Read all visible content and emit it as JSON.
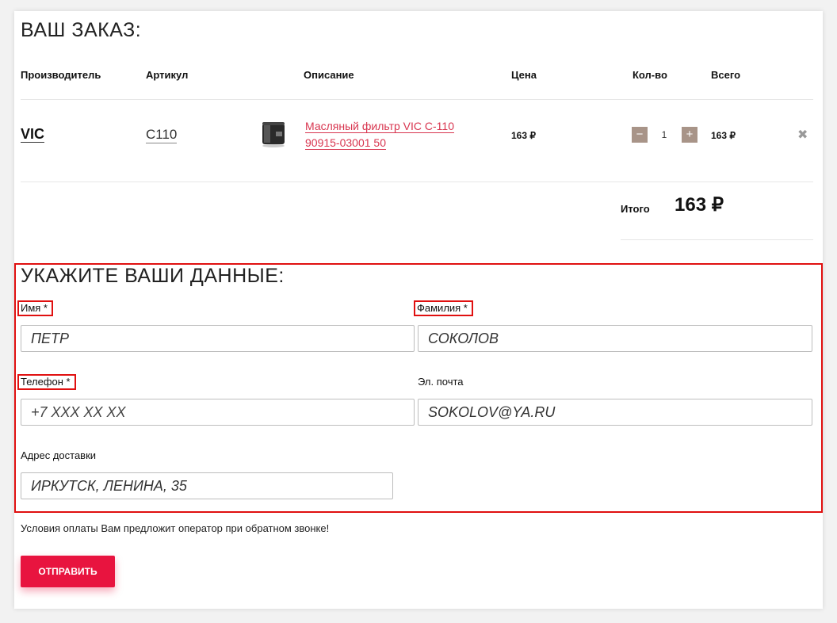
{
  "order": {
    "title": "ВАШ ЗАКАЗ:",
    "columns": [
      "Производитель",
      "Артикул",
      "Описание",
      "Цена",
      "Кол-во",
      "Всего"
    ],
    "item": {
      "brand": "VIC",
      "article": "C110",
      "description_line1": "Масляный фильтр VIC C-110",
      "description_line2": "90915-03001 50",
      "price": "163 ₽",
      "qty_minus": "−",
      "qty": "1",
      "qty_plus": "+",
      "total": "163 ₽",
      "remove": "✖"
    },
    "total_label": "Итого",
    "total_value": "163 ₽"
  },
  "form": {
    "title": "УКАЖИТЕ ВАШИ ДАННЫЕ:",
    "first_name": {
      "label": "Имя *",
      "value": "ПЕТР"
    },
    "last_name": {
      "label": "Фамилия *",
      "value": "СОКОЛОВ"
    },
    "phone": {
      "label": "Телефон *",
      "value": "+7 XXX XX XX"
    },
    "email": {
      "label": "Эл. почта",
      "value": "SOKOLOV@YA.RU"
    },
    "address": {
      "label": "Адрес доставки",
      "value": "ИРКУТСК, ЛЕНИНА, 35"
    }
  },
  "note": "Условия оплаты Вам предложит оператор при обратном звонке!",
  "submit_label": "ОТПРАВИТЬ",
  "colors": {
    "accent": "#e8143f",
    "link": "#d8354f",
    "highlight_border": "#e01010",
    "qty_button": "#a89488"
  }
}
